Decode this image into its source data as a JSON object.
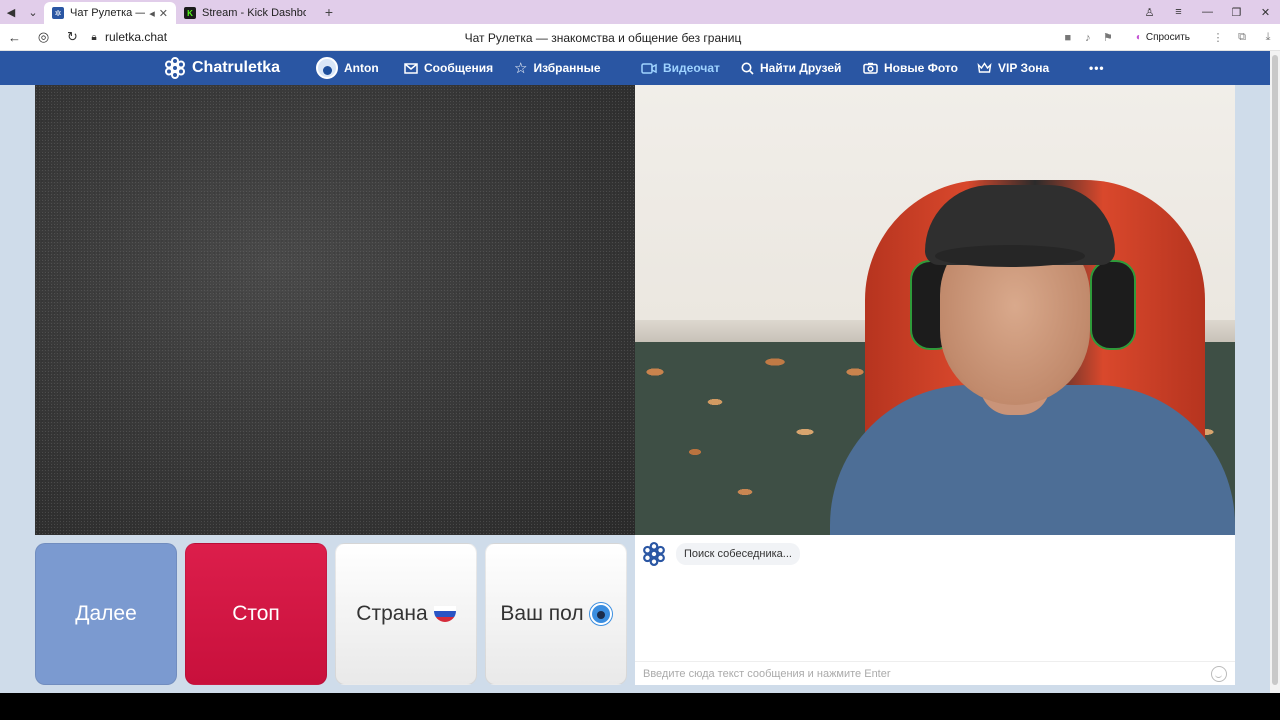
{
  "browser": {
    "tabs": [
      {
        "title": "Чат Рулетка — знакомства",
        "active": true
      },
      {
        "title": "Stream - Kick Dashboard",
        "active": false
      }
    ],
    "address": "ruletka.chat",
    "page_title": "Чат Рулетка — знакомства и общение без границ",
    "ask_label": "Спросить"
  },
  "header": {
    "logo": "Chatruletka",
    "user": "Anton",
    "nav": {
      "messages": "Сообщения",
      "favorites": "Избранные",
      "videochat": "Видеочат",
      "find_friends": "Найти Друзей",
      "new_photos": "Новые Фото",
      "vip": "VIP Зона",
      "more": "•••"
    }
  },
  "controls": {
    "next": "Далее",
    "stop": "Стоп",
    "country": "Страна",
    "gender": "Ваш пол"
  },
  "chat": {
    "status": "Поиск собеседника...",
    "placeholder": "Введите сюда текст сообщения и нажмите Enter"
  },
  "colors": {
    "header_bg": "#2a56a3",
    "active_nav": "#9fd3ff",
    "stop": "#d0154a",
    "next": "#7b9ad0"
  }
}
